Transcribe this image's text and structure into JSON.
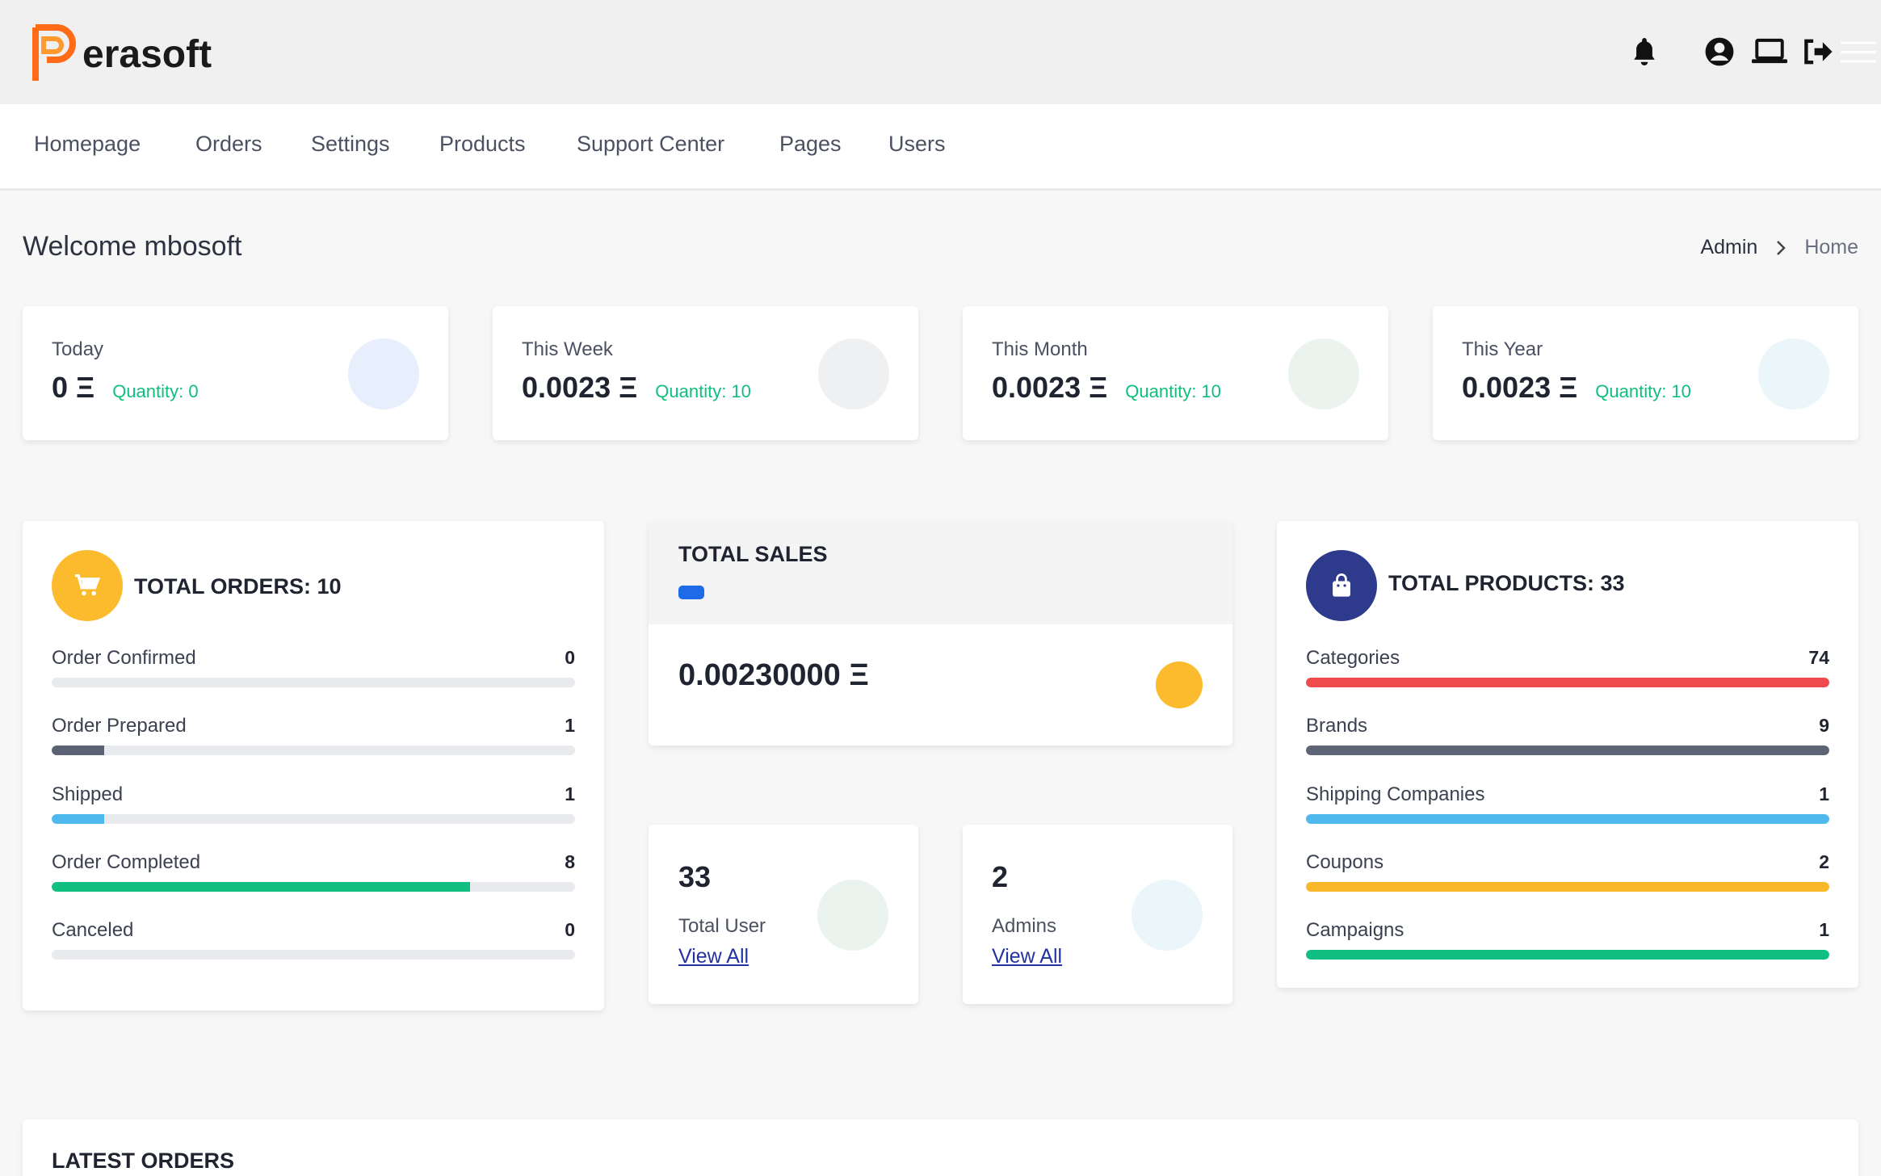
{
  "brand": {
    "name": "erasoft"
  },
  "header_icons": [
    "bell-icon",
    "user-circle-icon",
    "laptop-icon",
    "logout-icon",
    "menu-icon"
  ],
  "nav": [
    "Homepage",
    "Orders",
    "Settings",
    "Products",
    "Support Center",
    "Pages",
    "Users"
  ],
  "welcome": "Welcome mbosoft",
  "breadcrumb": {
    "admin": "Admin",
    "home": "Home"
  },
  "stats": [
    {
      "label": "Today",
      "value": "0 Ξ",
      "quantity": "Quantity: 0",
      "color": "#e8effc"
    },
    {
      "label": "This Week",
      "value": "0.0023 Ξ",
      "quantity": "Quantity: 10",
      "color": "#eff0f2"
    },
    {
      "label": "This Month",
      "value": "0.0023 Ξ",
      "quantity": "Quantity: 10",
      "color": "#ebf3ee"
    },
    {
      "label": "This Year",
      "value": "0.0023 Ξ",
      "quantity": "Quantity: 10",
      "color": "#eaf6f9"
    }
  ],
  "orders": {
    "title": "TOTAL ORDERS: 10",
    "items": [
      {
        "label": "Order Confirmed",
        "count": "0",
        "fraction": 0,
        "color": "#6b7384"
      },
      {
        "label": "Order Prepared",
        "count": "1",
        "fraction": 0.1,
        "color": "#5a6273"
      },
      {
        "label": "Shipped",
        "count": "1",
        "fraction": 0.1,
        "color": "#4fb9ee"
      },
      {
        "label": "Order Completed",
        "count": "8",
        "fraction": 0.8,
        "color": "#11bf82"
      },
      {
        "label": "Canceled",
        "count": "0",
        "fraction": 0,
        "color": "#e34848"
      }
    ]
  },
  "sales": {
    "title": "TOTAL SALES",
    "value": "0.00230000 Ξ"
  },
  "users": {
    "count": "33",
    "label": "Total User",
    "link": "View All"
  },
  "admins": {
    "count": "2",
    "label": "Admins",
    "link": "View All"
  },
  "products": {
    "title": "TOTAL PRODUCTS: 33",
    "items": [
      {
        "label": "Categories",
        "count": "74",
        "fraction": 1,
        "color": "#ef4b4f"
      },
      {
        "label": "Brands",
        "count": "9",
        "fraction": 1,
        "color": "#5d6575"
      },
      {
        "label": "Shipping Companies",
        "count": "1",
        "fraction": 1,
        "color": "#4fb9ee"
      },
      {
        "label": "Coupons",
        "count": "2",
        "fraction": 1,
        "color": "#f8b829"
      },
      {
        "label": "Campaigns",
        "count": "1",
        "fraction": 1,
        "color": "#11bf82"
      }
    ]
  },
  "latest_orders": {
    "title": "LATEST ORDERS"
  },
  "colors": {
    "accent_green": "#0fbf7d",
    "orders_icon_bg": "#fbbb2d",
    "products_icon_bg": "#2e3a8c",
    "sales_dot": "#fbbb2d",
    "sales_badge": "#1f6ae8",
    "logo_orange": "#ff6b17"
  }
}
